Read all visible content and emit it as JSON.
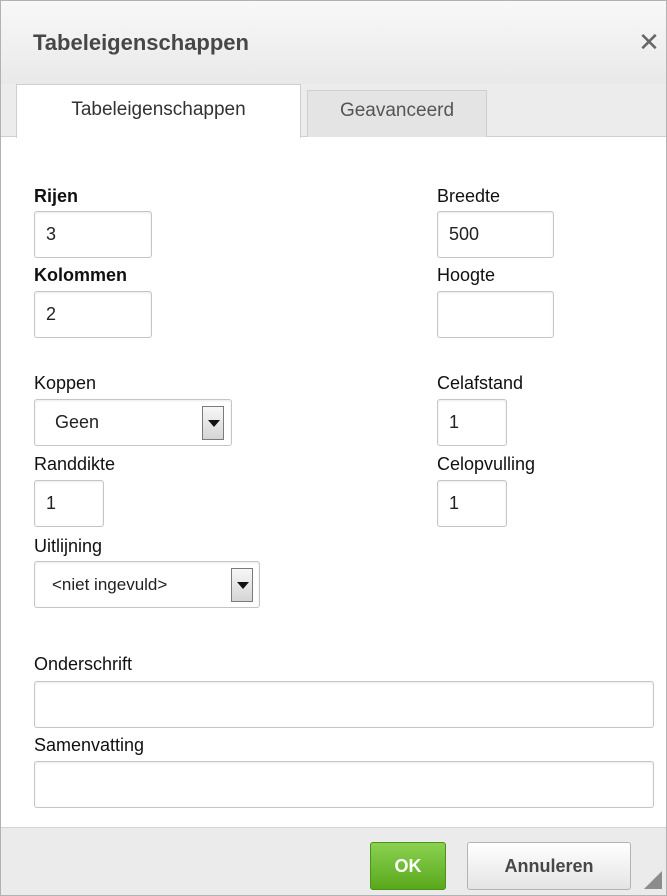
{
  "dialog": {
    "title": "Tabeleigenschappen",
    "close_icon": "close-icon"
  },
  "tabs": [
    {
      "label": "Tabeleigenschappen",
      "active": true
    },
    {
      "label": "Geavanceerd",
      "active": false
    }
  ],
  "fields": {
    "rows": {
      "label": "Rijen",
      "value": "3"
    },
    "columns": {
      "label": "Kolommen",
      "value": "2"
    },
    "width": {
      "label": "Breedte",
      "value": "500"
    },
    "height": {
      "label": "Hoogte",
      "value": ""
    },
    "headers": {
      "label": "Koppen",
      "selected": "Geen"
    },
    "cell_spacing": {
      "label": "Celafstand",
      "value": "1"
    },
    "border": {
      "label": "Randdikte",
      "value": "1"
    },
    "cell_padding": {
      "label": "Celopvulling",
      "value": "1"
    },
    "alignment": {
      "label": "Uitlijning",
      "selected": "<niet ingevuld>"
    },
    "caption": {
      "label": "Onderschrift",
      "value": ""
    },
    "summary": {
      "label": "Samenvatting",
      "value": ""
    }
  },
  "footer": {
    "ok_label": "OK",
    "cancel_label": "Annuleren"
  },
  "colors": {
    "ok_button": "#6cbf2f",
    "titlebar": "#f0f0f0"
  }
}
